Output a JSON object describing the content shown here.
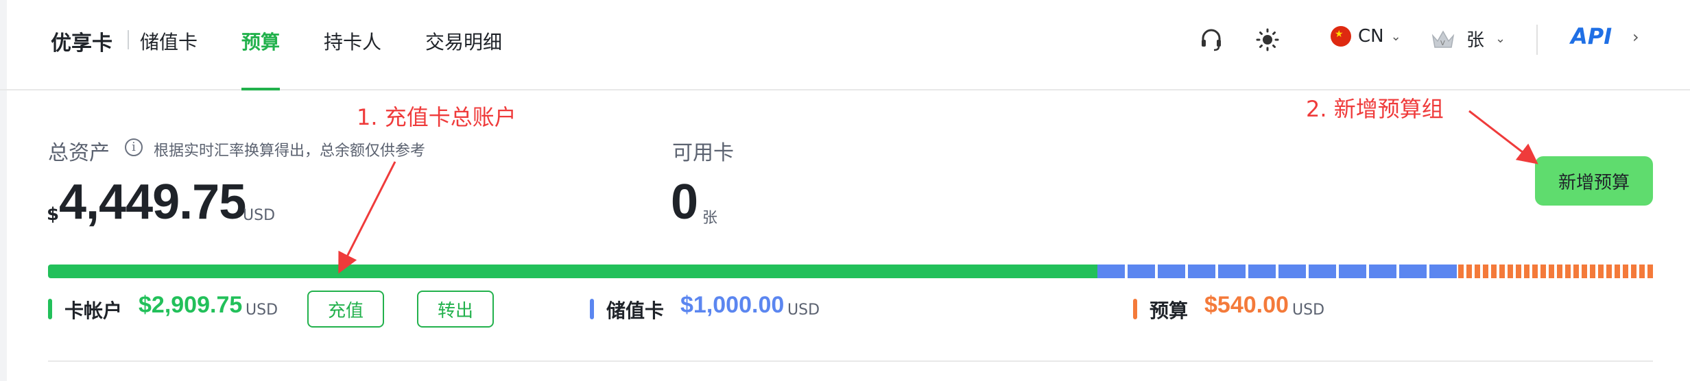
{
  "header": {
    "brand": "优享卡",
    "brand_sub": "储值卡",
    "tabs": [
      {
        "label": "预算",
        "active": true
      },
      {
        "label": "持卡人",
        "active": false
      },
      {
        "label": "交易明细",
        "active": false
      }
    ],
    "icons": [
      "headset-icon",
      "theme-sun-icon"
    ],
    "language": "CN",
    "user_name": "张",
    "api_label": "API"
  },
  "summary": {
    "total_label": "总资产",
    "total_hint": "根据实时汇率换算得出，总余额仅供参考",
    "currency_symbol": "$",
    "total_value": "4,449.75",
    "total_unit": "USD",
    "cards_label": "可用卡",
    "cards_value": "0",
    "cards_unit": "张",
    "add_budget_button": "新增预算"
  },
  "breakdown": {
    "account": {
      "label": "卡帐户",
      "value": "$2,909.75",
      "unit": "USD",
      "color": "#22c05a"
    },
    "recharge_button": "充值",
    "transfer_button": "转出",
    "stored_card": {
      "label": "储值卡",
      "value": "$1,000.00",
      "unit": "USD",
      "color": "#5b86f0"
    },
    "budget": {
      "label": "预算",
      "value": "$540.00",
      "unit": "USD",
      "color": "#f47a3a"
    }
  },
  "annotations": {
    "a1": "1. 充值卡总账户",
    "a2": "2. 新增预算组",
    "color": "#ef3b3b"
  },
  "colors": {
    "accent": "#22b14c",
    "button_fill": "#5fdc6e"
  }
}
